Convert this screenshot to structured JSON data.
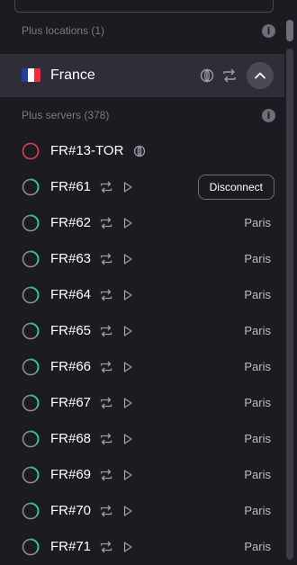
{
  "colors": {
    "background": "#1c1b22",
    "selected_row": "#2f2e38",
    "ring_connected_tor": "#e0405b",
    "ring_load": "#2fbf8f",
    "ring_track": "#8a8994",
    "flag_blue": "#1f3fa8",
    "flag_white": "#ffffff",
    "flag_red": "#e8303c"
  },
  "locations_section": {
    "label": "Plus locations (1)",
    "icon": "info-icon"
  },
  "country": {
    "name": "France",
    "flag_icon": "france-flag-icon",
    "features": [
      "tor-onion-icon",
      "p2p-arrows-icon"
    ],
    "expand_icon": "chevron-up-icon"
  },
  "servers_section": {
    "label": "Plus servers (378)",
    "icon": "info-icon"
  },
  "servers": [
    {
      "name": "FR#13-TOR",
      "load": 0.85,
      "status": "connected",
      "features": [
        "tor-onion-icon"
      ],
      "city": "",
      "action": ""
    },
    {
      "name": "FR#61",
      "load": 0.35,
      "status": "",
      "features": [
        "p2p-arrows-icon",
        "streaming-play-icon"
      ],
      "city": "",
      "action": "Disconnect"
    },
    {
      "name": "FR#62",
      "load": 0.35,
      "status": "",
      "features": [
        "p2p-arrows-icon",
        "streaming-play-icon"
      ],
      "city": "Paris",
      "action": ""
    },
    {
      "name": "FR#63",
      "load": 0.35,
      "status": "",
      "features": [
        "p2p-arrows-icon",
        "streaming-play-icon"
      ],
      "city": "Paris",
      "action": ""
    },
    {
      "name": "FR#64",
      "load": 0.35,
      "status": "",
      "features": [
        "p2p-arrows-icon",
        "streaming-play-icon"
      ],
      "city": "Paris",
      "action": ""
    },
    {
      "name": "FR#65",
      "load": 0.35,
      "status": "",
      "features": [
        "p2p-arrows-icon",
        "streaming-play-icon"
      ],
      "city": "Paris",
      "action": ""
    },
    {
      "name": "FR#66",
      "load": 0.35,
      "status": "",
      "features": [
        "p2p-arrows-icon",
        "streaming-play-icon"
      ],
      "city": "Paris",
      "action": ""
    },
    {
      "name": "FR#67",
      "load": 0.35,
      "status": "",
      "features": [
        "p2p-arrows-icon",
        "streaming-play-icon"
      ],
      "city": "Paris",
      "action": ""
    },
    {
      "name": "FR#68",
      "load": 0.35,
      "status": "",
      "features": [
        "p2p-arrows-icon",
        "streaming-play-icon"
      ],
      "city": "Paris",
      "action": ""
    },
    {
      "name": "FR#69",
      "load": 0.35,
      "status": "",
      "features": [
        "p2p-arrows-icon",
        "streaming-play-icon"
      ],
      "city": "Paris",
      "action": ""
    },
    {
      "name": "FR#70",
      "load": 0.35,
      "status": "",
      "features": [
        "p2p-arrows-icon",
        "streaming-play-icon"
      ],
      "city": "Paris",
      "action": ""
    },
    {
      "name": "FR#71",
      "load": 0.35,
      "status": "",
      "features": [
        "p2p-arrows-icon",
        "streaming-play-icon"
      ],
      "city": "Paris",
      "action": ""
    }
  ]
}
